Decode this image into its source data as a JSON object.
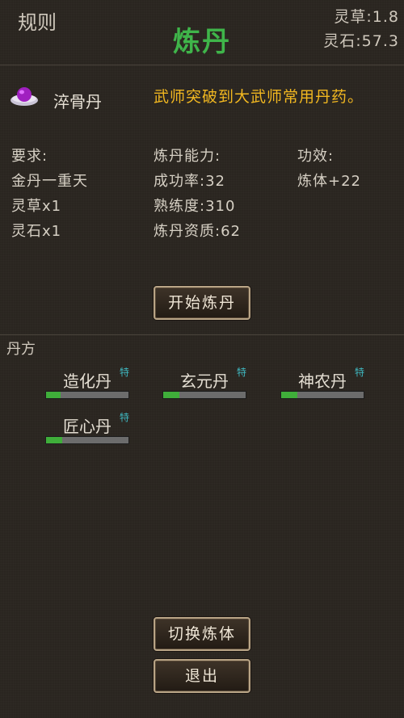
{
  "header": {
    "rules_label": "规则",
    "title": "炼丹",
    "resource_herb": "灵草:1.8",
    "resource_stone": "灵石:57.3"
  },
  "pill": {
    "icon": "pill-bowl-icon",
    "name": "淬骨丹",
    "description": "武师突破到大武师常用丹药。"
  },
  "requirements": {
    "header": "要求:",
    "items": [
      "金丹一重天",
      "灵草x1",
      "灵石x1"
    ]
  },
  "ability": {
    "header": "炼丹能力:",
    "items": [
      "成功率:32",
      "熟练度:310",
      "炼丹资质:62"
    ]
  },
  "effect": {
    "header": "功效:",
    "items": [
      "炼体+22"
    ]
  },
  "buttons": {
    "start": "开始炼丹",
    "switch": "切换炼体",
    "exit": "退出"
  },
  "recipes": {
    "label": "丹方",
    "items": [
      {
        "name": "造化丹",
        "tag": "特",
        "progress": 0.18
      },
      {
        "name": "玄元丹",
        "tag": "特",
        "progress": 0.2
      },
      {
        "name": "神农丹",
        "tag": "特",
        "progress": 0.2
      },
      {
        "name": "匠心丹",
        "tag": "特",
        "progress": 0.2
      }
    ]
  },
  "colors": {
    "title": "#3fb54a",
    "description": "#f2b820",
    "progress_fill": "#3fae3a",
    "tag": "#3fb8c0"
  }
}
